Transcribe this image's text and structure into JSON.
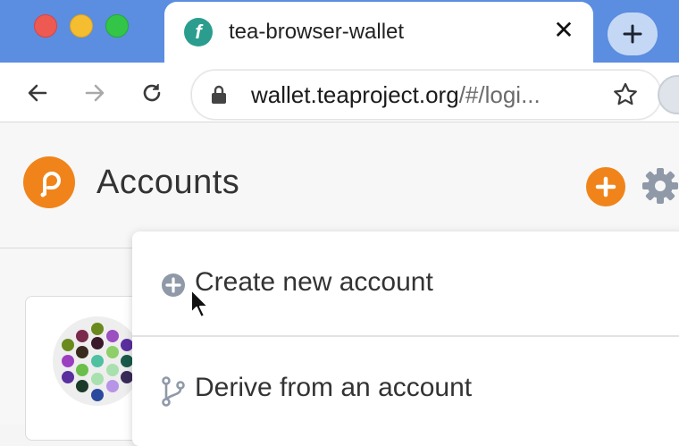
{
  "browser": {
    "tab": {
      "title": "tea-browser-wallet",
      "favicon_letter": "f",
      "close_glyph": "✕"
    },
    "url": {
      "host": "wallet.teaproject.org",
      "path": "/#/logi..."
    },
    "colors": {
      "titlebar": "#5b8de0",
      "accent": "#f0841a"
    }
  },
  "app": {
    "title": "Accounts",
    "icons": [
      "polkadot-logo-icon",
      "add-circle-icon",
      "gear-icon"
    ]
  },
  "menu": {
    "items": [
      {
        "label": "Create new account",
        "icon": "plus-circle-icon"
      },
      {
        "label": "Derive from an account",
        "icon": "branch-icon"
      }
    ]
  }
}
